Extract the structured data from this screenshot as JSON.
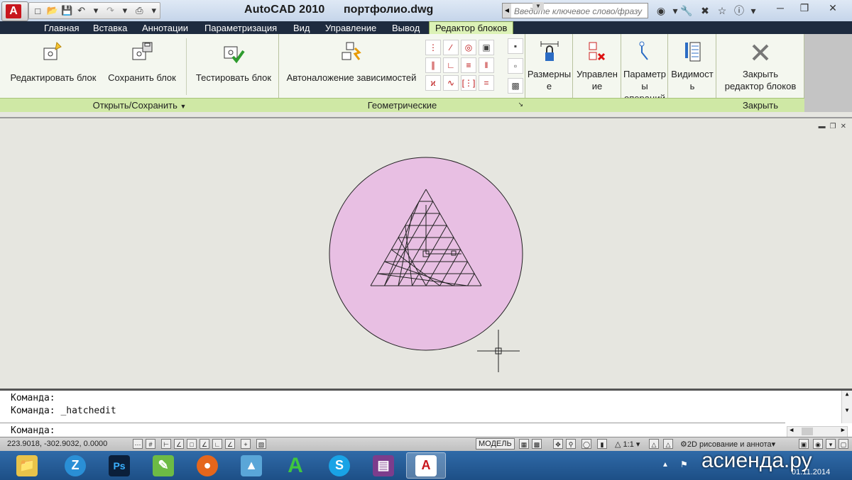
{
  "window": {
    "app_title": "AutoCAD 2010",
    "file_title": "портфолио.dwg",
    "search_placeholder": "Введите ключевое слово/фразу"
  },
  "tabs": [
    {
      "label": "Главная"
    },
    {
      "label": "Вставка"
    },
    {
      "label": "Аннотации"
    },
    {
      "label": "Параметризация"
    },
    {
      "label": "Вид"
    },
    {
      "label": "Управление"
    },
    {
      "label": "Вывод"
    },
    {
      "label": "Редактор блоков",
      "active": true
    }
  ],
  "ribbon": {
    "open_save": {
      "edit_block": "Редактировать блок",
      "save_block": "Сохранить блок",
      "footer": "Открыть/Сохранить"
    },
    "test_block": "Тестировать блок",
    "geometric": {
      "auto_constrain": "Автоналожение зависимостей",
      "footer": "Геометрические"
    },
    "dimensions": {
      "line1": "Размерны",
      "line2": "е"
    },
    "manage": {
      "line1": "Управлен",
      "line2": "ие"
    },
    "params": {
      "line1": "Параметр",
      "line2": "ы",
      "line3": "операций"
    },
    "visibility": {
      "line1": "Видимост",
      "line2": "ь"
    },
    "close": {
      "line1": "Закрыть",
      "line2": "редактор блоков",
      "footer": "Закрыть"
    }
  },
  "drawing": {
    "circle_fill": "#e8bfe3",
    "background": "#e6e6e0"
  },
  "command": {
    "line1": "Команда:",
    "line2": "Команда:  _hatchedit",
    "prompt": "Команда:"
  },
  "status": {
    "coords": "223.9018,  -302.9032, 0.0000",
    "model": "МОДЕЛЬ",
    "scale": "1:1",
    "workspace": "2D рисование и аннота"
  },
  "taskbar": {
    "watermark": "асиенда.ру",
    "date": "01.11.2014"
  },
  "colors": {
    "autocad_red": "#c8161d",
    "ribbon_green": "#cfe8a5",
    "tab_bar": "#1e2b3f"
  }
}
